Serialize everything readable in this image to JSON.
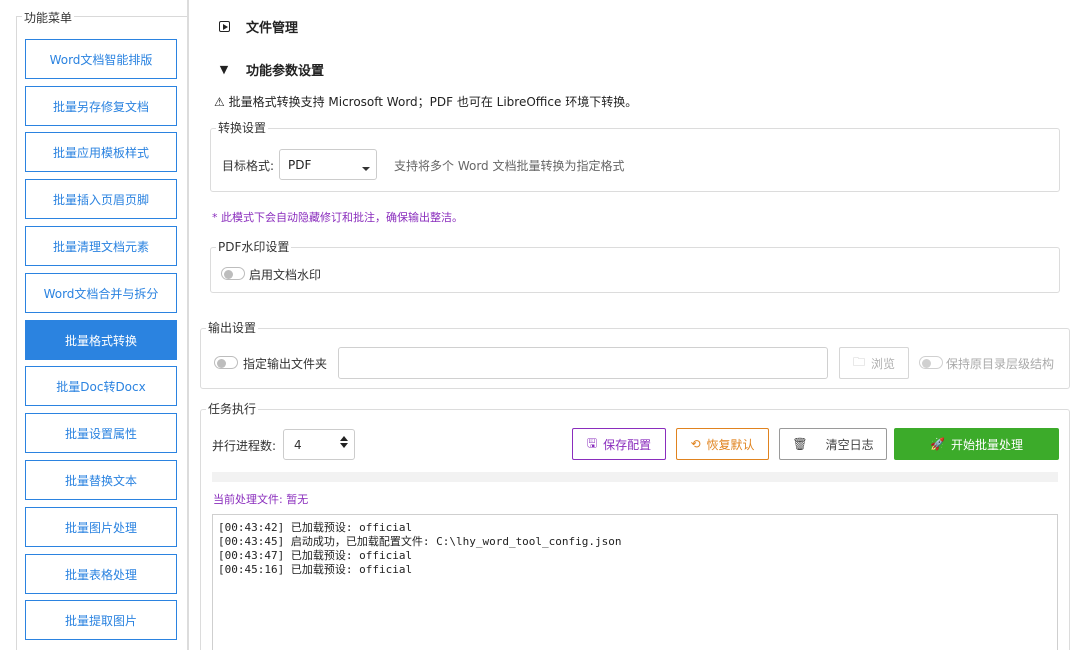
{
  "sidebar": {
    "title": "功能菜单",
    "items": [
      {
        "label": "Word文档智能排版",
        "active": false
      },
      {
        "label": "批量另存修复文档",
        "active": false
      },
      {
        "label": "批量应用模板样式",
        "active": false
      },
      {
        "label": "批量插入页眉页脚",
        "active": false
      },
      {
        "label": "批量清理文档元素",
        "active": false
      },
      {
        "label": "Word文档合并与拆分",
        "active": false
      },
      {
        "label": "批量格式转换",
        "active": true
      },
      {
        "label": "批量Doc转Docx",
        "active": false
      },
      {
        "label": "批量设置属性",
        "active": false
      },
      {
        "label": "批量替换文本",
        "active": false
      },
      {
        "label": "批量图片处理",
        "active": false
      },
      {
        "label": "批量表格处理",
        "active": false
      },
      {
        "label": "批量提取图片",
        "active": false
      }
    ]
  },
  "sections": {
    "file_manage": "文件管理",
    "param_settings": "功能参数设置"
  },
  "notice": "⚠ 批量格式转换支持 Microsoft Word；PDF 也可在 LibreOffice 环境下转换。",
  "convert": {
    "legend": "转换设置",
    "target_label": "目标格式:",
    "target_value": "PDF",
    "hint": "支持将多个 Word 文档批量转换为指定格式"
  },
  "mode_note": "* 此模式下会自动隐藏修订和批注，确保输出整洁。",
  "watermark": {
    "legend": "PDF水印设置",
    "toggle_label": "启用文档水印",
    "enabled": false
  },
  "output": {
    "legend": "输出设置",
    "toggle_label": "指定输出文件夹",
    "path_value": "",
    "browse_label": "浏览",
    "keep_structure_label": "保持原目录层级结构"
  },
  "task": {
    "legend": "任务执行",
    "parallel_label": "并行进程数:",
    "parallel_value": "4",
    "save_label": "保存配置",
    "restore_label": "恢复默认",
    "clear_label": "清空日志",
    "start_label": "开始批量处理",
    "progress": 0,
    "current_file": "当前处理文件: 暂无",
    "log": [
      "[00:43:42] 已加载预设: official",
      "[00:43:45] 启动成功，已加载配置文件: C:\\lhy_word_tool_config.json",
      "[00:43:47] 已加载预设: official",
      "[00:45:16] 已加载预设: official"
    ]
  },
  "colors": {
    "accent": "#2b83e0",
    "save": "#8a2dbd",
    "restore": "#e0831f",
    "start": "#3cab2a"
  }
}
